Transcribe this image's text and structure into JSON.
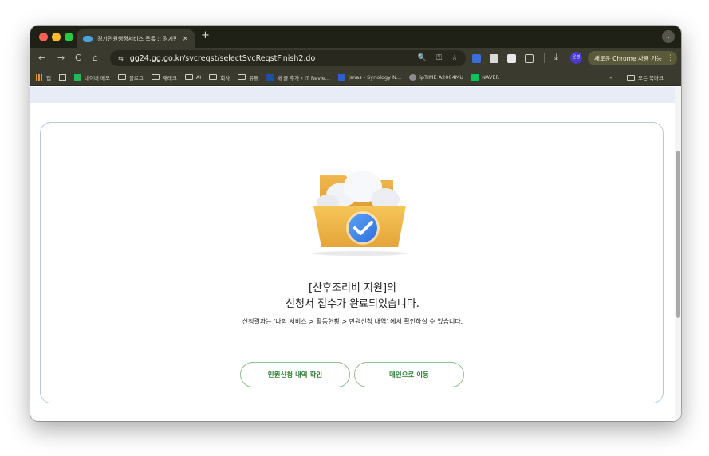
{
  "tab": {
    "title": "경기민원행정서비스 목록 :: 경기민",
    "close": "×",
    "new_tab": "+"
  },
  "toolbar": {
    "back": "←",
    "forward": "→",
    "reload": "C",
    "home": "⌂",
    "url": "gg24.gg.go.kr/svcreqst/selectSvcReqstFinish2.do",
    "site_icon": "⇆",
    "zoom_icon": "🔍",
    "key_icon": "⚿",
    "star_icon": "☆",
    "download_icon": "⤓",
    "profile_label": "운영",
    "update_label": "새로운 Chrome 사용 가능",
    "menu_icon": "⋮"
  },
  "bookmarks": {
    "apps_label": "앱",
    "items": [
      {
        "label": "네이버 메모",
        "color": "#27b75a"
      },
      {
        "label": "블로그",
        "folder": true
      },
      {
        "label": "재테크",
        "folder": true
      },
      {
        "label": "AI",
        "folder": true
      },
      {
        "label": "회사",
        "folder": true
      },
      {
        "label": "유튜",
        "folder": true
      },
      {
        "label": "새 글 추가 ‹ IT Revie...",
        "color": "#1f4ea8"
      },
      {
        "label": "jsnas - Synology N...",
        "color": "#2a63c8"
      },
      {
        "label": "ipTIME A2004MU",
        "color": "#8c8c8c"
      },
      {
        "label": "NAVER",
        "color": "#03c75a"
      }
    ],
    "overflow": "»",
    "all_bookmarks": "모든 북마크"
  },
  "content": {
    "title_line1": "[산후조리비 지원]의",
    "title_line2": "신청서 접수가 완료되었습니다.",
    "description": "신청결과는 '나의 서비스 > 활동현황 > 민원신청 내역' 에서 확인하실 수 있습니다.",
    "btn_history": "민원신청 내역 확인",
    "btn_main": "메인으로 이동"
  },
  "colors": {
    "accent_green": "#2f7d32",
    "button_border": "#8fc08f",
    "card_border": "#b7c7e2",
    "page_band": "#e7ecf6"
  }
}
